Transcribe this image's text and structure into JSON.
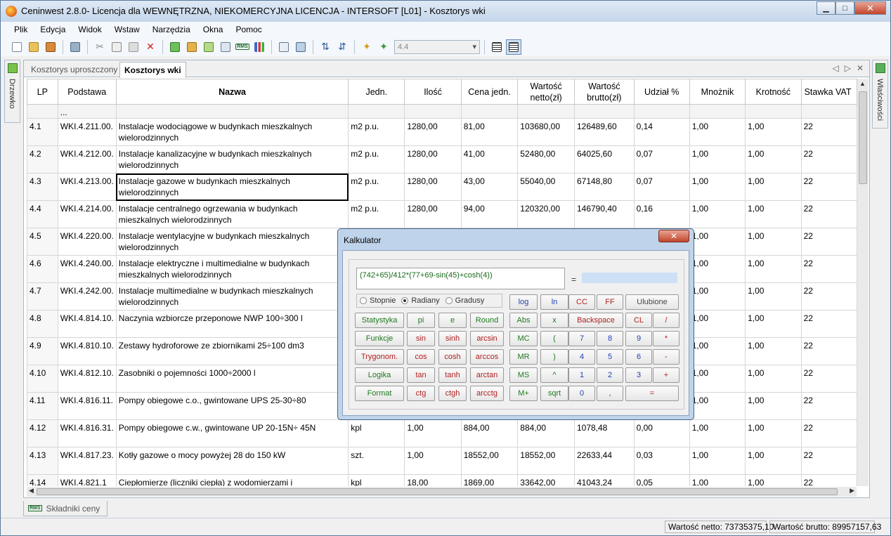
{
  "window": {
    "title": "Ceninwest 2.8.0- Licencja dla WEWNĘTRZNA, NIEKOMERCYJNA LICENCJA - INTERSOFT [L01] - Kosztorys wki",
    "minimize": "▁",
    "maximize": "□",
    "close": "✕"
  },
  "menu": [
    "Plik",
    "Edycja",
    "Widok",
    "Wstaw",
    "Narzędzia",
    "Okna",
    "Pomoc"
  ],
  "toolbar": {
    "zoom_value": "4.4"
  },
  "left_dock": {
    "label": "Drzewko"
  },
  "right_dock": {
    "label": "Właściwości"
  },
  "doc_tabs": [
    {
      "label": "Kosztorys uproszczony"
    },
    {
      "label": "Kosztorys wki"
    }
  ],
  "tab_controls": {
    "prev": "◁",
    "next": "▷",
    "close": "✕"
  },
  "grid": {
    "columns": [
      "LP",
      "Podstawa",
      "Nazwa",
      "Jedn.",
      "Ilość",
      "Cena jedn.",
      "Wartość netto(zł)",
      "Wartość brutto(zł)",
      "Udział %",
      "Mnożnik",
      "Krotność",
      "Stawka VAT"
    ],
    "dots_row": "...",
    "rows": [
      {
        "lp": "4.1",
        "podstawa": "WKI.4.211.00.",
        "nazwa": "Instalacje wodociągowe w budynkach mieszkalnych wielorodzinnych",
        "jedn": "m2 p.u.",
        "ilosc": "1280,00",
        "cena": "81,00",
        "netto": "103680,00",
        "brutto": "126489,60",
        "udzial": "0,14",
        "mnoznik": "1,00",
        "krotnosc": "1,00",
        "vat": "22"
      },
      {
        "lp": "4.2",
        "podstawa": "WKI.4.212.00.",
        "nazwa": "Instalacje kanalizacyjne w budynkach mieszkalnych wielorodzinnych",
        "jedn": "m2 p.u.",
        "ilosc": "1280,00",
        "cena": "41,00",
        "netto": "52480,00",
        "brutto": "64025,60",
        "udzial": "0,07",
        "mnoznik": "1,00",
        "krotnosc": "1,00",
        "vat": "22"
      },
      {
        "lp": "4.3",
        "podstawa": "WKI.4.213.00.",
        "nazwa": "Instalacje gazowe w budynkach mieszkalnych wielorodzinnych",
        "jedn": "m2 p.u.",
        "ilosc": "1280,00",
        "cena": "43,00",
        "netto": "55040,00",
        "brutto": "67148,80",
        "udzial": "0,07",
        "mnoznik": "1,00",
        "krotnosc": "1,00",
        "vat": "22"
      },
      {
        "lp": "4.4",
        "podstawa": "WKI.4.214.00.",
        "nazwa": "Instalacje centralnego ogrzewania w budynkach mieszkalnych wielorodzinnych",
        "jedn": "m2 p.u.",
        "ilosc": "1280,00",
        "cena": "94,00",
        "netto": "120320,00",
        "brutto": "146790,40",
        "udzial": "0,16",
        "mnoznik": "1,00",
        "krotnosc": "1,00",
        "vat": "22"
      },
      {
        "lp": "4.5",
        "podstawa": "WKI.4.220.00.",
        "nazwa": "Instalacje wentylacyjne w budynkach mieszkalnych wielorodzinnych",
        "jedn": "",
        "ilosc": "",
        "cena": "",
        "netto": "",
        "brutto": "",
        "udzial": "",
        "mnoznik": "1,00",
        "krotnosc": "1,00",
        "vat": "22"
      },
      {
        "lp": "4.6",
        "podstawa": "WKI.4.240.00.",
        "nazwa": "Instalacje elektryczne i multimedialne w budynkach mieszkalnych wielorodzinnych",
        "jedn": "",
        "ilosc": "",
        "cena": "",
        "netto": "",
        "brutto": "",
        "udzial": "",
        "mnoznik": "1,00",
        "krotnosc": "1,00",
        "vat": "22"
      },
      {
        "lp": "4.7",
        "podstawa": "WKI.4.242.00.",
        "nazwa": "Instalacje multimedialne w budynkach mieszkalnych wielorodzinnych",
        "jedn": "",
        "ilosc": "",
        "cena": "",
        "netto": "",
        "brutto": "",
        "udzial": "",
        "mnoznik": "1,00",
        "krotnosc": "1,00",
        "vat": "22"
      },
      {
        "lp": "4.8",
        "podstawa": "WKI.4.814.10.",
        "nazwa": "Naczynia wzbiorcze przeponowe NWP 100÷300 l",
        "jedn": "",
        "ilosc": "",
        "cena": "",
        "netto": "",
        "brutto": "",
        "udzial": "",
        "mnoznik": "1,00",
        "krotnosc": "1,00",
        "vat": "22"
      },
      {
        "lp": "4.9",
        "podstawa": "WKI.4.810.10.",
        "nazwa": "Zestawy hydroforowe  ze zbiornikami 25÷100 dm3",
        "jedn": "",
        "ilosc": "",
        "cena": "",
        "netto": "",
        "brutto": "",
        "udzial": "",
        "mnoznik": "1,00",
        "krotnosc": "1,00",
        "vat": "22"
      },
      {
        "lp": "4.10",
        "podstawa": "WKI.4.812.10.",
        "nazwa": "Zasobniki o pojemności 1000÷2000 l",
        "jedn": "",
        "ilosc": "",
        "cena": "",
        "netto": "",
        "brutto": "",
        "udzial": "",
        "mnoznik": "1,00",
        "krotnosc": "1,00",
        "vat": "22"
      },
      {
        "lp": "4.11",
        "podstawa": "WKI.4.816.11.",
        "nazwa": "Pompy obiegowe c.o., gwintowane UPS 25-30÷80",
        "jedn": "",
        "ilosc": "",
        "cena": "",
        "netto": "",
        "brutto": "",
        "udzial": "",
        "mnoznik": "1,00",
        "krotnosc": "1,00",
        "vat": "22"
      },
      {
        "lp": "4.12",
        "podstawa": "WKI.4.816.31.",
        "nazwa": "Pompy obiegowe c.w., gwintowane UP 20-15N÷ 45N",
        "jedn": "kpl",
        "ilosc": "1,00",
        "cena": "884,00",
        "netto": "884,00",
        "brutto": "1078,48",
        "udzial": "0,00",
        "mnoznik": "1,00",
        "krotnosc": "1,00",
        "vat": "22"
      },
      {
        "lp": "4.13",
        "podstawa": "WKI.4.817.23.",
        "nazwa": "Kotły gazowe o mocy powyżej 28 do 150 kW",
        "jedn": "szt.",
        "ilosc": "1,00",
        "cena": "18552,00",
        "netto": "18552,00",
        "brutto": "22633,44",
        "udzial": "0,03",
        "mnoznik": "1,00",
        "krotnosc": "1,00",
        "vat": "22"
      },
      {
        "lp": "4.14",
        "podstawa": "WKI.4.821.1",
        "nazwa": "Ciepłomierze (liczniki ciepła) z wodomierzami i",
        "jedn": "kpl",
        "ilosc": "18,00",
        "cena": "1869,00",
        "netto": "33642,00",
        "brutto": "41043,24",
        "udzial": "0,05",
        "mnoznik": "1,00",
        "krotnosc": "1,00",
        "vat": "22"
      }
    ]
  },
  "bottom_tab": {
    "label": "Składniki ceny",
    "icon_text": "RMS"
  },
  "status": {
    "netto": "Wartość netto: 73735375,10",
    "brutto": "Wartość brutto: 89957157,63"
  },
  "calculator": {
    "title": "Kalkulator",
    "close": "✕",
    "expression": "(742+65)/412*(77+69-sin(45)+cosh(4))",
    "equals": "=",
    "result": "",
    "modes": [
      {
        "label": "Stopnie",
        "checked": false
      },
      {
        "label": "Radiany",
        "checked": true
      },
      {
        "label": "Gradusy",
        "checked": false
      }
    ],
    "buttons": {
      "log": "log",
      "ln": "ln",
      "cc": "CC",
      "ff": "FF",
      "ulubione": "Ulubione",
      "statystyka": "Statystyka",
      "pi": "pi",
      "e": "e",
      "round": "Round",
      "abs": "Abs",
      "x": "x",
      "backspace": "Backspace",
      "cl": "CL",
      "div": "/",
      "funkcje": "Funkcje",
      "sin": "sin",
      "sinh": "sinh",
      "arcsin": "arcsin",
      "mc": "MC",
      "lpar": "(",
      "n7": "7",
      "n8": "8",
      "n9": "9",
      "mul": "*",
      "trygonom": "Trygonom.",
      "cos": "cos",
      "cosh": "cosh",
      "arccos": "arccos",
      "mr": "MR",
      "rpar": ")",
      "n4": "4",
      "n5": "5",
      "n6": "6",
      "sub": "-",
      "logika": "Logika",
      "tan": "tan",
      "tanh": "tanh",
      "arctan": "arctan",
      "ms": "MS",
      "pow": "^",
      "n1": "1",
      "n2": "2",
      "n3": "3",
      "add": "+",
      "format": "Format",
      "ctg": "ctg",
      "ctgh": "ctgh",
      "arcctg": "arcctg",
      "mplus": "M+",
      "sqrt": "sqrt",
      "n0": "0",
      "comma": ",",
      "eq": "="
    }
  }
}
